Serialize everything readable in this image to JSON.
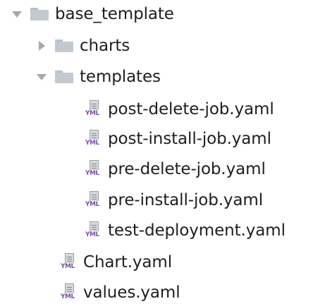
{
  "tree": {
    "root": {
      "label": "base_template",
      "expanded": true,
      "icon": "folder-icon"
    },
    "charts": {
      "label": "charts",
      "expanded": false,
      "icon": "folder-icon"
    },
    "templates": {
      "label": "templates",
      "expanded": true,
      "icon": "folder-icon",
      "files": [
        {
          "label": "post-delete-job.yaml",
          "icon": "yaml-file-icon"
        },
        {
          "label": "post-install-job.yaml",
          "icon": "yaml-file-icon"
        },
        {
          "label": "pre-delete-job.yaml",
          "icon": "yaml-file-icon"
        },
        {
          "label": "pre-install-job.yaml",
          "icon": "yaml-file-icon"
        },
        {
          "label": "test-deployment.yaml",
          "icon": "yaml-file-icon"
        }
      ]
    },
    "root_files": [
      {
        "label": "Chart.yaml",
        "icon": "yaml-file-icon"
      },
      {
        "label": "values.yaml",
        "icon": "yaml-file-icon"
      }
    ],
    "file_icon_tag": "YML"
  },
  "colors": {
    "arrow": "#a8a8a8",
    "folder": "#c3c9d0",
    "yml_tag": "#7b4ea8",
    "text": "#1e1e1e"
  }
}
